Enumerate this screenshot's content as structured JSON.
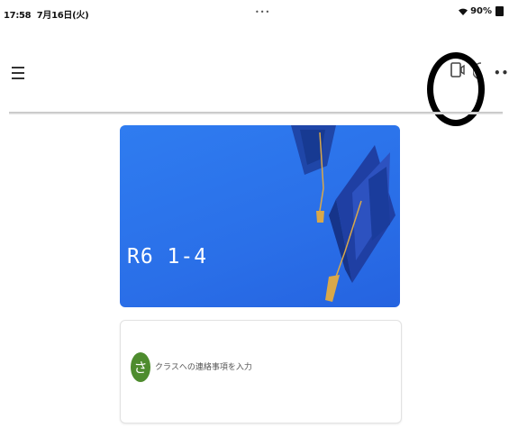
{
  "status_bar": {
    "time": "17:58",
    "date": "7月16日(火)",
    "center_dots": "•••",
    "battery_percent": "90%",
    "icons": [
      "wifi-icon",
      "battery-icon"
    ]
  },
  "app_bar": {
    "icons": [
      "menu-icon",
      "tablet-icon",
      "more-icon"
    ],
    "more_label": "•••"
  },
  "class_card": {
    "title": "R6 1-4",
    "banner_color": "#2f7cf0"
  },
  "stream": {
    "avatar_initial": "さ",
    "avatar_color": "#4e8c2e",
    "post_placeholder": "クラスへの連絡事項を入力"
  }
}
